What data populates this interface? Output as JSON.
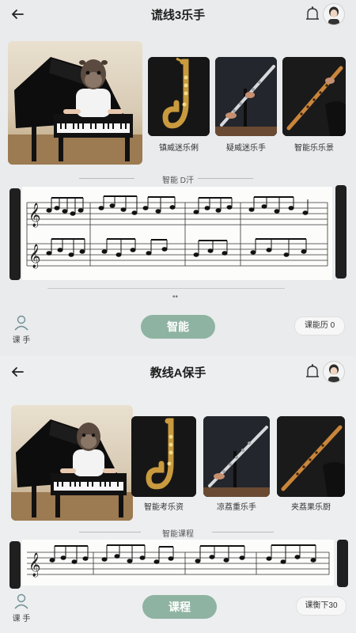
{
  "top": {
    "title": "谎线3乐手",
    "instruments": [
      {
        "name": "sax",
        "label": "镇威迷乐俐"
      },
      {
        "name": "flute",
        "label": "疑威迷乐手"
      },
      {
        "name": "bamboo",
        "label": "智能乐乐景"
      }
    ],
    "section_label": "智能 D汗",
    "main_button": "智能",
    "student_label": "课 手",
    "counter": "课能历 0"
  },
  "bottom": {
    "title": "教线A保手",
    "instruments": [
      {
        "name": "sax",
        "label": "智能考乐资"
      },
      {
        "name": "flute",
        "label": "凉荔重乐手"
      },
      {
        "name": "bamboo",
        "label": "夹荔果乐厨"
      }
    ],
    "section_label": "智能课程",
    "main_button": "课程",
    "student_label": "课 手",
    "counter": "课衡下30"
  },
  "colors": {
    "accent": "#8fb3a2",
    "background": "#e9ebec",
    "dark": "#1f1f1f"
  },
  "icons": [
    "back-arrow-icon",
    "bell-icon",
    "avatar",
    "user-icon",
    "treble-clef-icon"
  ]
}
